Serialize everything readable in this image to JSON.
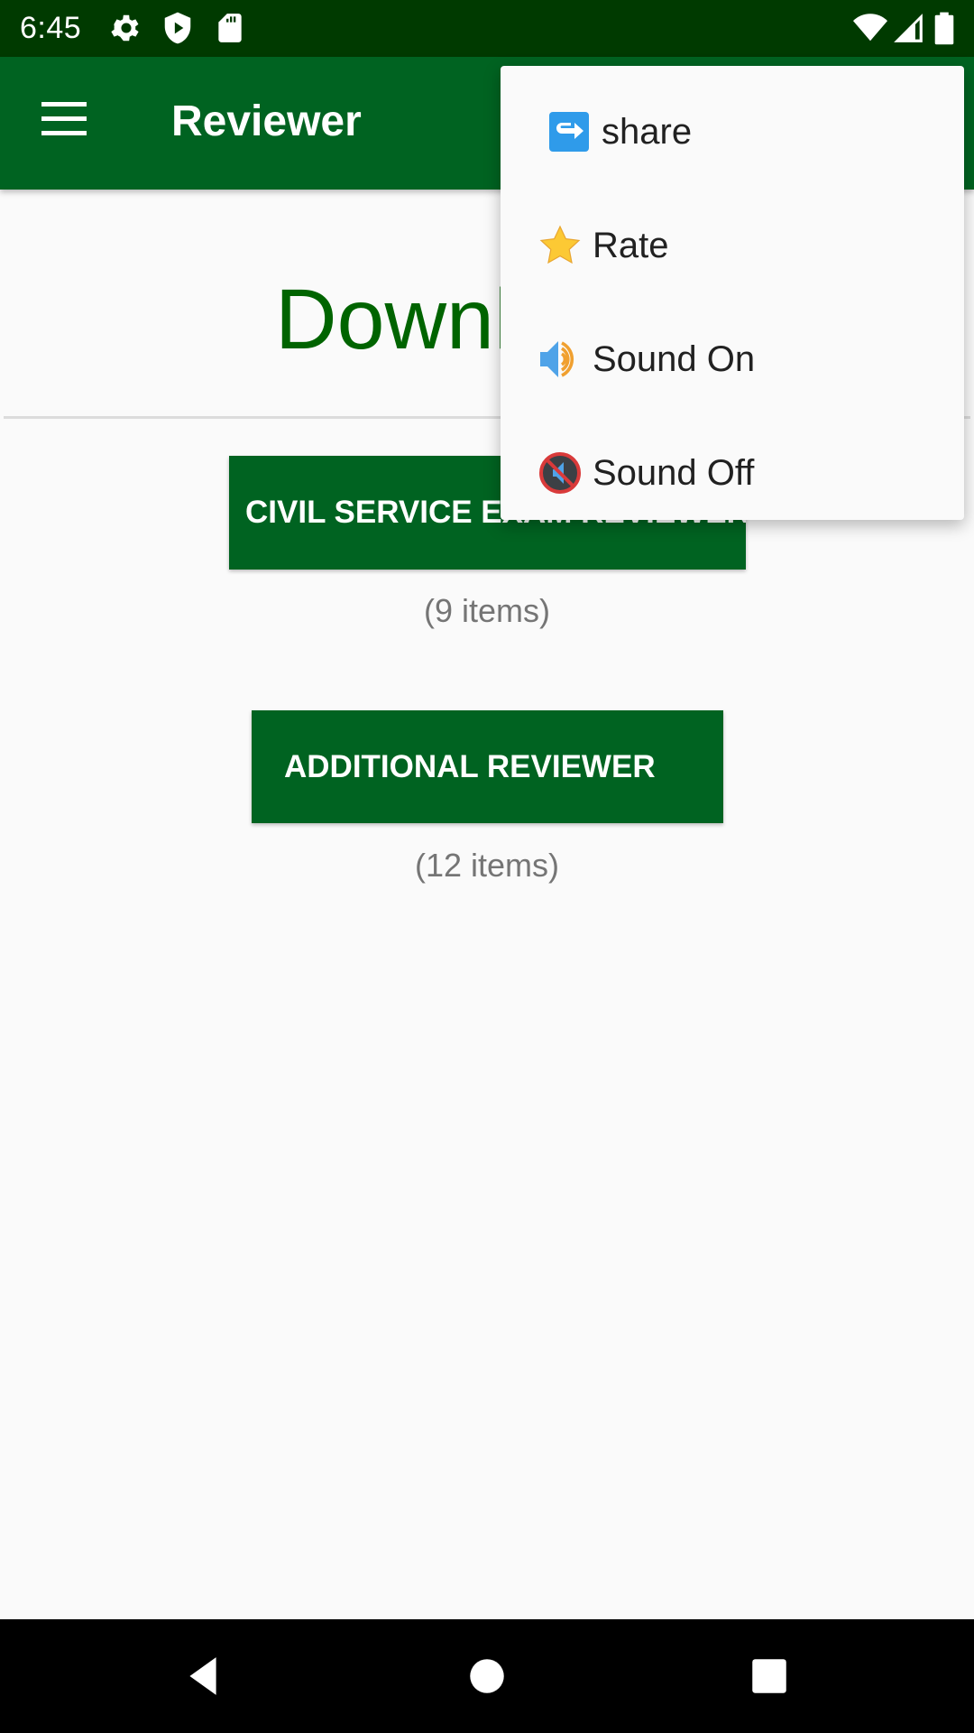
{
  "status_bar": {
    "time": "6:45",
    "left_icons": [
      "gear-icon",
      "shield-play-icon",
      "sd-card-icon"
    ],
    "right_icons": [
      "wifi-icon",
      "cell-signal-icon",
      "battery-icon"
    ]
  },
  "app_bar": {
    "title": "Reviewer",
    "nav_icon": "hamburger-menu-icon"
  },
  "main": {
    "heading": "Downloads",
    "buttons": [
      {
        "label": "CIVIL SERVICE EXAM REVIEWER",
        "count": "(9 items)"
      },
      {
        "label": "ADDITIONAL REVIEWER",
        "count": "(12 items)"
      }
    ]
  },
  "overflow_menu": {
    "items": [
      {
        "label": "share",
        "icon": "share-arrow-icon"
      },
      {
        "label": "Rate",
        "icon": "star-icon"
      },
      {
        "label": "Sound On",
        "icon": "speaker-on-icon"
      },
      {
        "label": "Sound Off",
        "icon": "speaker-muted-icon"
      }
    ]
  },
  "colors": {
    "status_bar": "#003a00",
    "primary": "#006321",
    "heading": "#006400",
    "background": "#fafafa"
  },
  "nav_bar": {
    "buttons": [
      "back-icon",
      "home-icon",
      "recents-icon"
    ]
  }
}
